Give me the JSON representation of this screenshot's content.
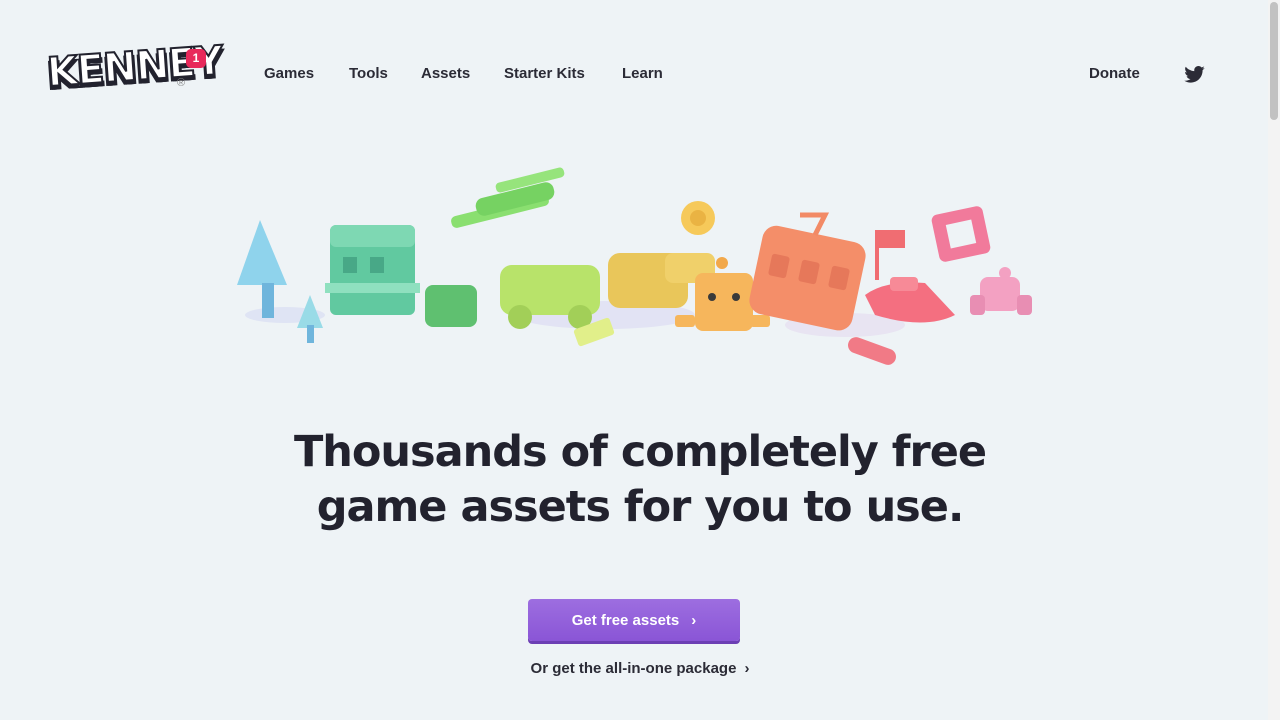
{
  "header": {
    "logo_text": "KENNEY",
    "logo_badge": "1",
    "logo_reg": "®",
    "nav": [
      {
        "label": "Games"
      },
      {
        "label": "Tools"
      },
      {
        "label": "Assets"
      },
      {
        "label": "Starter Kits"
      },
      {
        "label": "Learn"
      }
    ],
    "donate_label": "Donate",
    "social_icon": "twitter-icon"
  },
  "hero": {
    "headline_line1": "Thousands of completely free",
    "headline_line2": "game assets for you to use.",
    "cta_label": "Get free assets",
    "cta_chevron": "›",
    "alt_link_label": "Or get the all-in-one package",
    "alt_chevron": "›"
  },
  "colors": {
    "background": "#eef3f6",
    "accent": "#8a55d6",
    "badge": "#e8295b",
    "text": "#22222e"
  }
}
